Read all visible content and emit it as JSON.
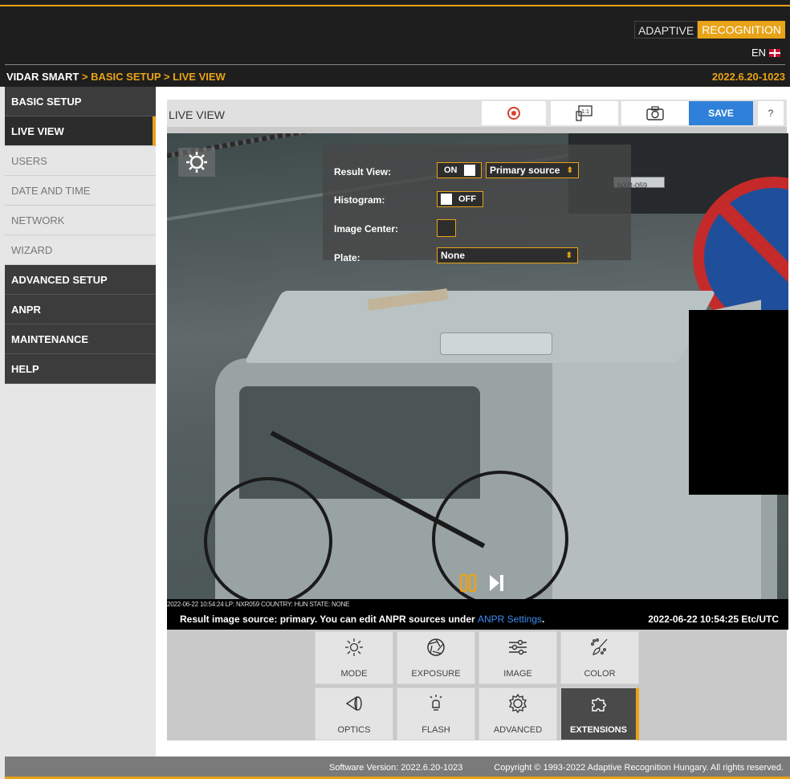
{
  "brand": {
    "part1": "ADAPTIVE",
    "part2": "RECOGNITION"
  },
  "language": {
    "code": "EN",
    "flag_icon": "uk-flag-icon"
  },
  "breadcrumb": {
    "root": "VIDAR SMART",
    "path": " > BASIC SETUP > LIVE VIEW"
  },
  "version_top": "2022.6.20-1023",
  "sidebar": {
    "items": [
      {
        "label": "BASIC SETUP",
        "kind": "section"
      },
      {
        "label": "LIVE VIEW",
        "kind": "active"
      },
      {
        "label": "USERS",
        "kind": "sub"
      },
      {
        "label": "DATE AND TIME",
        "kind": "sub"
      },
      {
        "label": "NETWORK",
        "kind": "sub"
      },
      {
        "label": "WIZARD",
        "kind": "sub"
      },
      {
        "label": "ADVANCED SETUP",
        "kind": "section"
      },
      {
        "label": "ANPR",
        "kind": "section"
      },
      {
        "label": "MAINTENANCE",
        "kind": "section"
      },
      {
        "label": "HELP",
        "kind": "section"
      }
    ]
  },
  "panel": {
    "title": "LIVE VIEW",
    "toolbar": {
      "record_icon": "record-icon",
      "ratio_label": "1:1",
      "snapshot_icon": "camera-icon",
      "save_label": "SAVE",
      "help_label": "?"
    }
  },
  "overlay": {
    "result_view": {
      "label": "Result View:",
      "state": "ON",
      "source": "Primary source"
    },
    "histogram": {
      "label": "Histogram:",
      "state": "OFF"
    },
    "image_center": {
      "label": "Image Center:"
    },
    "plate": {
      "label": "Plate:",
      "value": "None"
    }
  },
  "camera": {
    "plate_text": "NXR-059",
    "meta_line": "2022-06-22 10:54:24 LP: NXR059 COUNTRY: HUN STATE: NONE",
    "info_prefix": "Result image source: primary. You can edit ANPR sources under ",
    "info_link": "ANPR Settings",
    "info_suffix": ".",
    "timestamp": "2022-06-22 10:54:25 Etc/UTC"
  },
  "tools": [
    {
      "label": "MODE",
      "icon": "brightness-icon"
    },
    {
      "label": "EXPOSURE",
      "icon": "aperture-icon"
    },
    {
      "label": "IMAGE",
      "icon": "sliders-icon"
    },
    {
      "label": "COLOR",
      "icon": "color-brush-icon"
    },
    {
      "label": "OPTICS",
      "icon": "lens-icon"
    },
    {
      "label": "FLASH",
      "icon": "bulb-icon"
    },
    {
      "label": "ADVANCED",
      "icon": "gear-icon"
    },
    {
      "label": "EXTENSIONS",
      "icon": "puzzle-icon"
    }
  ],
  "footer": {
    "version": "Software Version:   2022.6.20-1023",
    "copyright": "Copyright © 1993-2022 Adaptive Recognition Hungary. All rights reserved."
  },
  "colors": {
    "accent": "#e8a317",
    "save_blue": "#2f80d8",
    "dark": "#1e1e1e"
  }
}
